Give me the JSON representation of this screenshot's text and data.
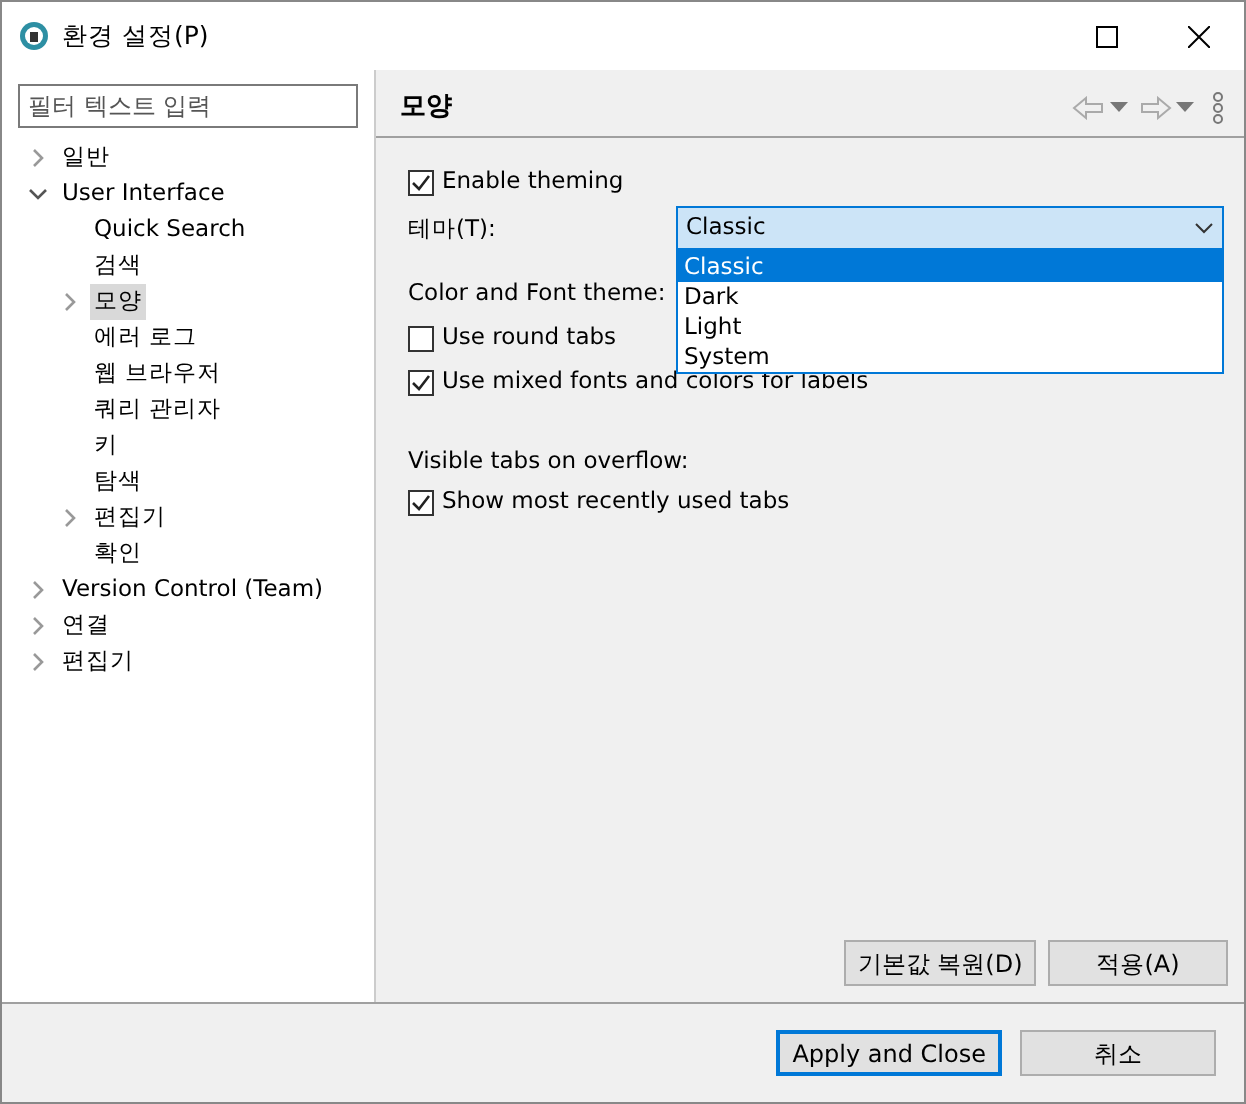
{
  "window": {
    "title": "환경 설정(P)"
  },
  "filter": {
    "placeholder": "필터 텍스트 입력"
  },
  "tree": [
    {
      "label": "일반",
      "kind": "branch",
      "expanded": false,
      "selected": false
    },
    {
      "label": "User Interface",
      "kind": "branch",
      "expanded": true,
      "selected": false,
      "children": [
        {
          "label": "Quick Search",
          "kind": "leaf",
          "selected": false
        },
        {
          "label": "검색",
          "kind": "leaf",
          "selected": false
        },
        {
          "label": "모양",
          "kind": "branch",
          "expanded": false,
          "selected": true
        },
        {
          "label": "에러 로그",
          "kind": "leaf",
          "selected": false
        },
        {
          "label": "웹 브라우저",
          "kind": "leaf",
          "selected": false
        },
        {
          "label": "쿼리 관리자",
          "kind": "leaf",
          "selected": false
        },
        {
          "label": "키",
          "kind": "leaf",
          "selected": false
        },
        {
          "label": "탐색",
          "kind": "leaf",
          "selected": false
        },
        {
          "label": "편집기",
          "kind": "branch",
          "expanded": false,
          "selected": false
        },
        {
          "label": "확인",
          "kind": "leaf",
          "selected": false
        }
      ]
    },
    {
      "label": "Version Control (Team)",
      "kind": "branch",
      "expanded": false,
      "selected": false
    },
    {
      "label": "연결",
      "kind": "branch",
      "expanded": false,
      "selected": false
    },
    {
      "label": "편집기",
      "kind": "branch",
      "expanded": false,
      "selected": false
    }
  ],
  "page": {
    "title": "모양",
    "enable_theming": {
      "label": "Enable theming",
      "checked": true
    },
    "theme": {
      "label": "테마(T):",
      "value": "Classic",
      "expanded": true,
      "options": [
        {
          "label": "Classic",
          "selected": true
        },
        {
          "label": "Dark",
          "selected": false
        },
        {
          "label": "Light",
          "selected": false
        },
        {
          "label": "System",
          "selected": false
        }
      ]
    },
    "color_font_label": "Color and Font theme:",
    "round_tabs": {
      "label": "Use round tabs",
      "checked": false
    },
    "mixed_fonts": {
      "label": "Use mixed fonts and colors for labels",
      "checked": true
    },
    "overflow_label": "Visible tabs on overflow:",
    "mru_tabs": {
      "label": "Show most recently used tabs",
      "checked": true
    },
    "buttons": [
      "기본값 복원(D)",
      "적용(A)"
    ]
  },
  "footer_buttons": [
    {
      "label": "Apply and Close",
      "default": true
    },
    {
      "label": "취소",
      "default": false
    }
  ]
}
